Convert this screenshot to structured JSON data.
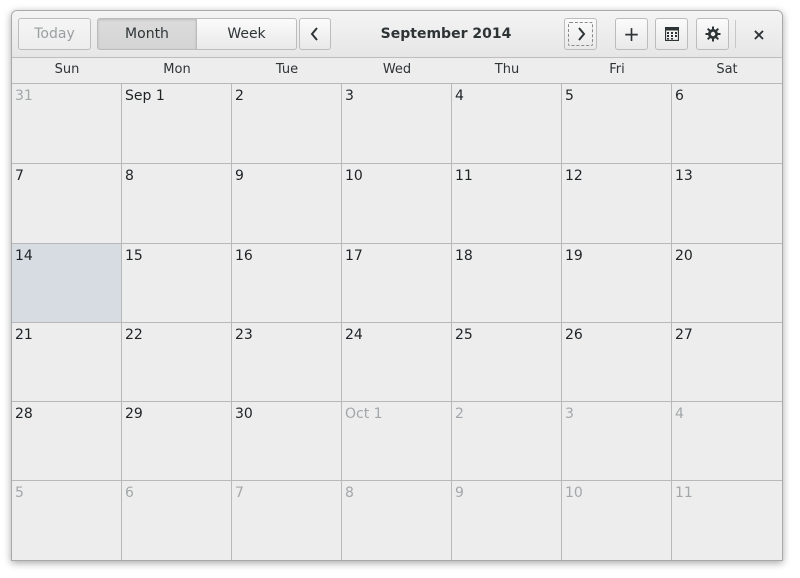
{
  "header": {
    "today_label": "Today",
    "month_label": "Month",
    "week_label": "Week",
    "title": "September 2014",
    "add_label": "+",
    "close_label": "×"
  },
  "weekdays": [
    "Sun",
    "Mon",
    "Tue",
    "Wed",
    "Thu",
    "Fri",
    "Sat"
  ],
  "weeks": [
    [
      {
        "label": "31",
        "other": true
      },
      {
        "label": "Sep 1"
      },
      {
        "label": "2"
      },
      {
        "label": "3"
      },
      {
        "label": "4"
      },
      {
        "label": "5"
      },
      {
        "label": "6"
      }
    ],
    [
      {
        "label": "7"
      },
      {
        "label": "8"
      },
      {
        "label": "9"
      },
      {
        "label": "10"
      },
      {
        "label": "11"
      },
      {
        "label": "12"
      },
      {
        "label": "13"
      }
    ],
    [
      {
        "label": "14",
        "selected": true
      },
      {
        "label": "15"
      },
      {
        "label": "16"
      },
      {
        "label": "17"
      },
      {
        "label": "18"
      },
      {
        "label": "19"
      },
      {
        "label": "20"
      }
    ],
    [
      {
        "label": "21"
      },
      {
        "label": "22"
      },
      {
        "label": "23"
      },
      {
        "label": "24"
      },
      {
        "label": "25"
      },
      {
        "label": "26"
      },
      {
        "label": "27"
      }
    ],
    [
      {
        "label": "28"
      },
      {
        "label": "29"
      },
      {
        "label": "30"
      },
      {
        "label": "Oct 1",
        "other": true
      },
      {
        "label": "2",
        "other": true
      },
      {
        "label": "3",
        "other": true
      },
      {
        "label": "4",
        "other": true
      }
    ],
    [
      {
        "label": "5",
        "other": true
      },
      {
        "label": "6",
        "other": true
      },
      {
        "label": "7",
        "other": true
      },
      {
        "label": "8",
        "other": true
      },
      {
        "label": "9",
        "other": true
      },
      {
        "label": "10",
        "other": true
      },
      {
        "label": "11",
        "other": true
      }
    ]
  ]
}
